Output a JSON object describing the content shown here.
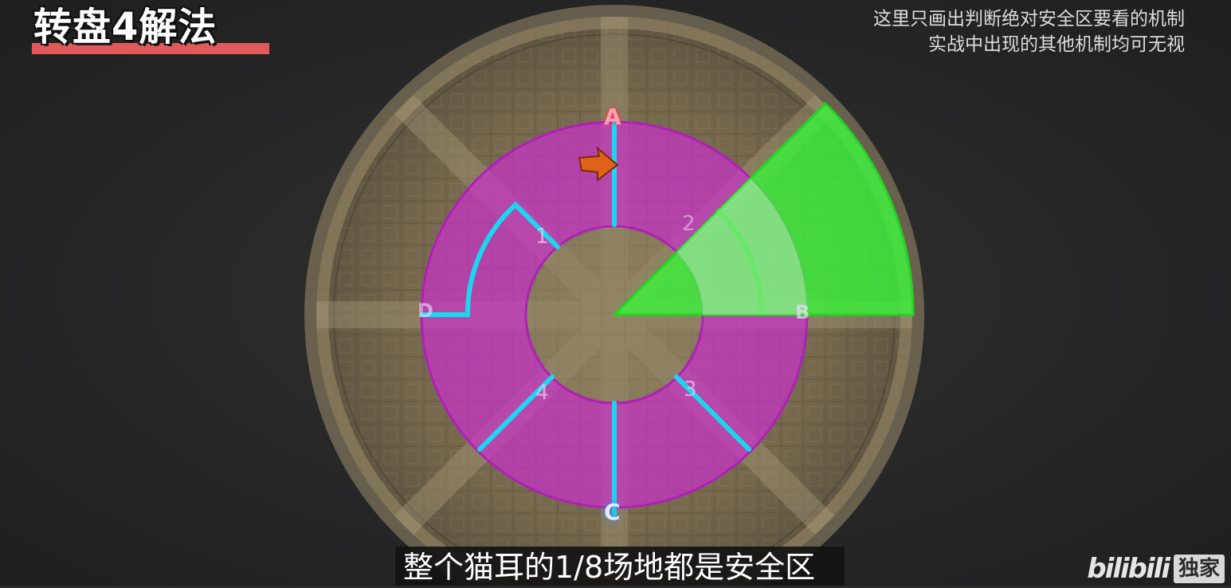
{
  "video": {
    "title": "转盘4解法",
    "note_lines": [
      "这里只画出判断绝对安全区要看的机制",
      "实战中出现的其他机制均可无视"
    ],
    "subtitle": "整个猫耳的1/8场地都是安全区",
    "watermark_logo": "bilibili",
    "watermark_badge": "独家"
  },
  "arena": {
    "markers": {
      "top": "A",
      "bottom": "C",
      "right": "B",
      "left": "D"
    },
    "sector_numbers": [
      "1",
      "2",
      "3",
      "4"
    ],
    "safe_zone_fraction": "1/8",
    "colors": {
      "ring": "#c832c8",
      "cyan_lines": "#19d7f0",
      "safe_zone": "#3cf03c",
      "marker_a": "#ff5a6e",
      "marker_c": "#5aa0ff",
      "player_arrow": "#e0621a"
    }
  }
}
